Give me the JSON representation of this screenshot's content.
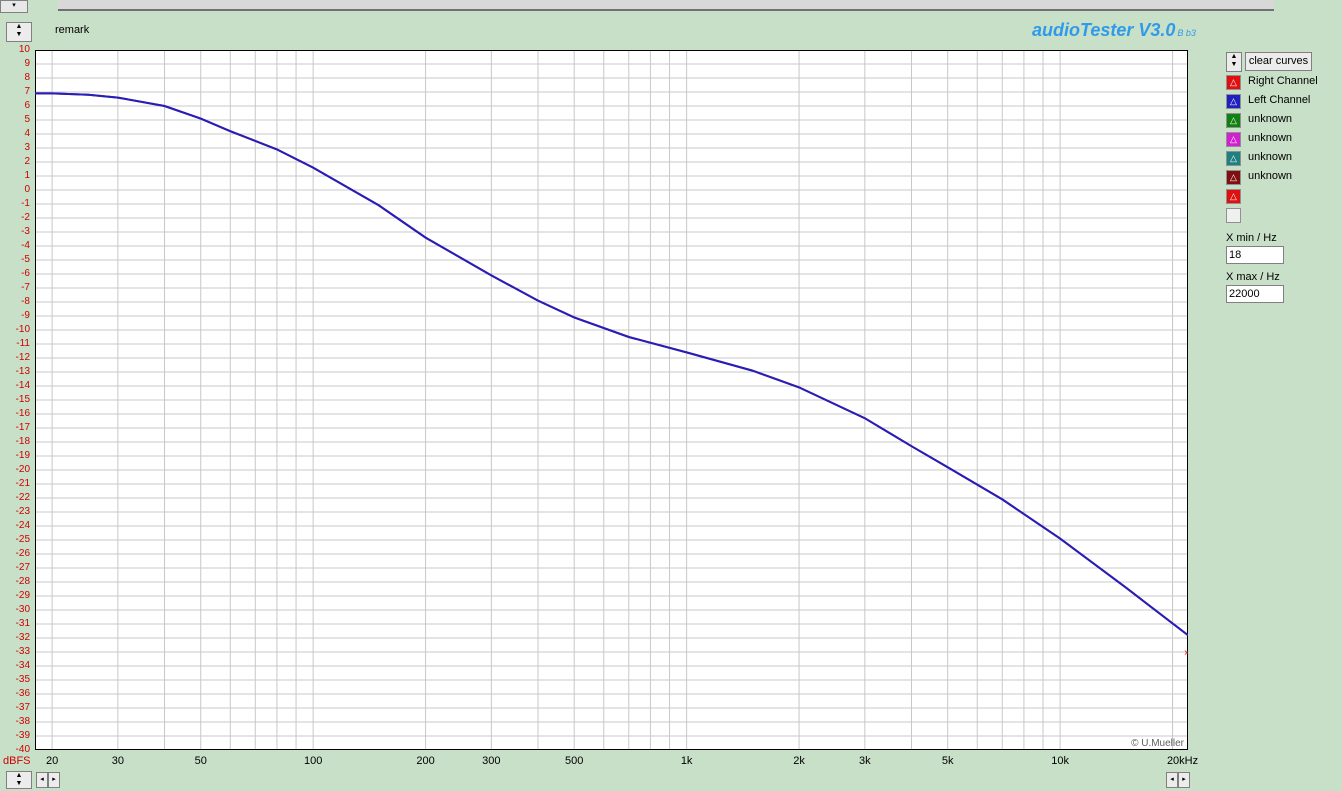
{
  "app": {
    "brand": "audioTester V3.0",
    "version_suffix": "B b3",
    "remark_label": "remark",
    "credit": "© U.Mueller"
  },
  "controls": {
    "clear_curves": "clear curves",
    "xmin_label": "X min / Hz",
    "xmin_value": "18",
    "xmax_label": "X max / Hz",
    "xmax_value": "22000"
  },
  "legend": [
    {
      "label": "Right Channel",
      "color": "#e01010"
    },
    {
      "label": "Left Channel",
      "color": "#2020c0"
    },
    {
      "label": "unknown",
      "color": "#108010"
    },
    {
      "label": "unknown",
      "color": "#d020d0"
    },
    {
      "label": "unknown",
      "color": "#208080"
    },
    {
      "label": "unknown",
      "color": "#801010"
    },
    {
      "label": "",
      "color": "#e01010"
    },
    {
      "label": "",
      "color": "#f0f0f0"
    }
  ],
  "chart_data": {
    "type": "line",
    "xscale": "log",
    "xlim": [
      18,
      22000
    ],
    "ylim": [
      -40,
      10
    ],
    "ylabel": "dBFS",
    "grid": true,
    "x_ticks": [
      {
        "value": 20,
        "label": "20"
      },
      {
        "value": 30,
        "label": "30"
      },
      {
        "value": 50,
        "label": "50"
      },
      {
        "value": 100,
        "label": "100"
      },
      {
        "value": 200,
        "label": "200"
      },
      {
        "value": 300,
        "label": "300"
      },
      {
        "value": 500,
        "label": "500"
      },
      {
        "value": 1000,
        "label": "1k"
      },
      {
        "value": 2000,
        "label": "2k"
      },
      {
        "value": 3000,
        "label": "3k"
      },
      {
        "value": 5000,
        "label": "5k"
      },
      {
        "value": 10000,
        "label": "10k"
      },
      {
        "value": 20000,
        "label": "20kHz"
      }
    ],
    "series": [
      {
        "name": "Right Channel",
        "color": "#d01010",
        "x": [
          18,
          20,
          25,
          30,
          40,
          50,
          60,
          80,
          100,
          150,
          200,
          300,
          400,
          500,
          700,
          1000,
          1500,
          2000,
          3000,
          4000,
          5000,
          7000,
          10000,
          15000,
          22000
        ],
        "y": [
          6.9,
          6.9,
          6.8,
          6.6,
          6.0,
          5.1,
          4.2,
          2.9,
          1.6,
          -1.1,
          -3.4,
          -6.1,
          -7.9,
          -9.1,
          -10.5,
          -11.6,
          -12.9,
          -14.1,
          -16.3,
          -18.3,
          -19.8,
          -22.1,
          -24.9,
          -28.4,
          -31.8
        ]
      },
      {
        "name": "Left Channel",
        "color": "#2020c0",
        "x": [
          18,
          20,
          25,
          30,
          40,
          50,
          60,
          80,
          100,
          150,
          200,
          300,
          400,
          500,
          700,
          1000,
          1500,
          2000,
          3000,
          4000,
          5000,
          7000,
          10000,
          15000,
          22000
        ],
        "y": [
          6.9,
          6.9,
          6.8,
          6.6,
          6.0,
          5.1,
          4.2,
          2.9,
          1.6,
          -1.1,
          -3.4,
          -6.1,
          -7.9,
          -9.1,
          -10.5,
          -11.6,
          -12.9,
          -14.1,
          -16.3,
          -18.3,
          -19.8,
          -22.1,
          -24.9,
          -28.4,
          -31.8
        ]
      }
    ]
  }
}
